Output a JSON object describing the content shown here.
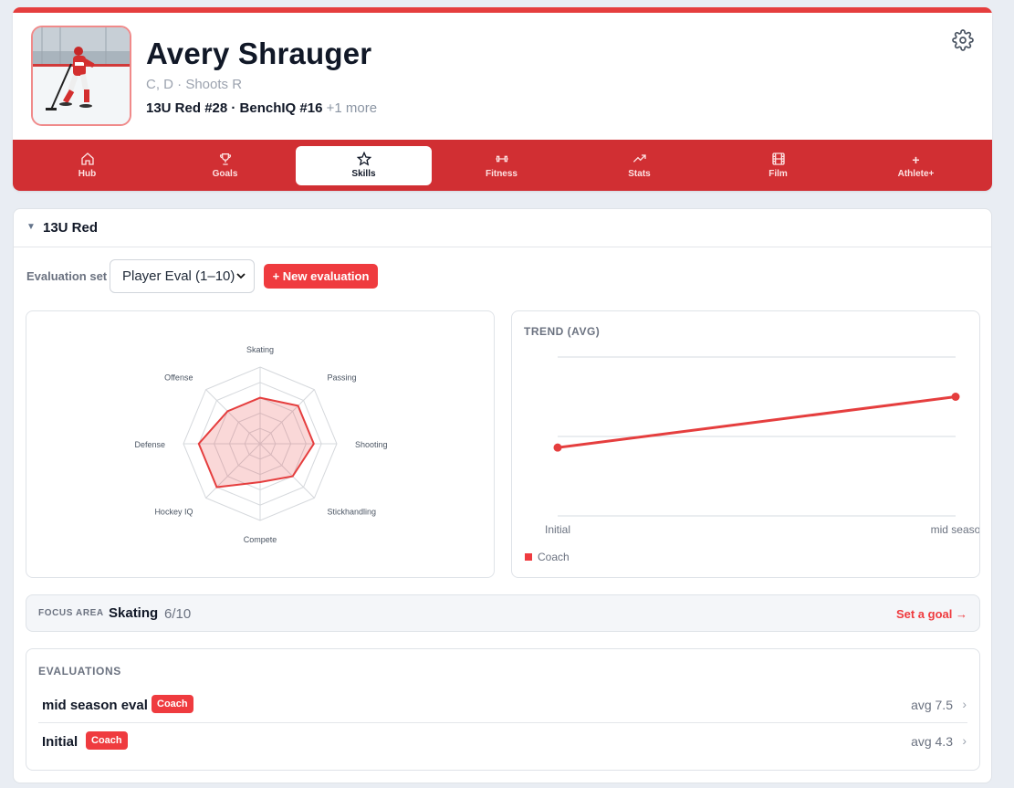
{
  "profile": {
    "name": "Avery Shrauger",
    "positions": "C, D · Shoots R",
    "teams": "13U Red #28 · BenchIQ #16",
    "more": "+1 more"
  },
  "nav": {
    "tabs": [
      {
        "label": "Hub",
        "icon": "home-icon"
      },
      {
        "label": "Goals",
        "icon": "trophy-icon"
      },
      {
        "label": "Skills",
        "icon": "star-icon"
      },
      {
        "label": "Fitness",
        "icon": "dumbbell-icon"
      },
      {
        "label": "Stats",
        "icon": "trending-icon"
      },
      {
        "label": "Film",
        "icon": "film-icon"
      },
      {
        "label": "Athlete+",
        "icon": "plus-icon"
      }
    ],
    "active": "Skills"
  },
  "section": {
    "team": "13U Red",
    "eval_set_label": "Evaluation set",
    "eval_set_value": "Player Eval (1–10)",
    "new_eval_label": "+ New evaluation"
  },
  "radar": {
    "axes": [
      "Skating",
      "Passing",
      "Shooting",
      "Stickhandling",
      "Compete",
      "Hockey IQ",
      "Defense",
      "Offense"
    ],
    "values": [
      6,
      7,
      7,
      6,
      5,
      8,
      8,
      6
    ],
    "max": 10,
    "color": "#e53e3e"
  },
  "chart_data": {
    "type": "line",
    "title": "TREND (AVG)",
    "categories": [
      "Initial",
      "mid seaso"
    ],
    "series": [
      {
        "name": "Coach",
        "values": [
          4.3,
          7.5
        ]
      }
    ],
    "ylim": [
      0,
      10
    ],
    "grid": true,
    "legend": "bottom-left"
  },
  "focus": {
    "label": "FOCUS AREA",
    "skill": "Skating",
    "score": "6/10",
    "action": "Set a goal →"
  },
  "evaluations": {
    "title": "EVALUATIONS",
    "items": [
      {
        "name": "mid season eval",
        "badge": "Coach",
        "avg": "avg 7.5"
      },
      {
        "name": "Initial",
        "badge": "Coach",
        "avg": "avg 4.3"
      }
    ]
  },
  "colors": {
    "accent": "#e53e3e",
    "nav": "#d12f33"
  }
}
